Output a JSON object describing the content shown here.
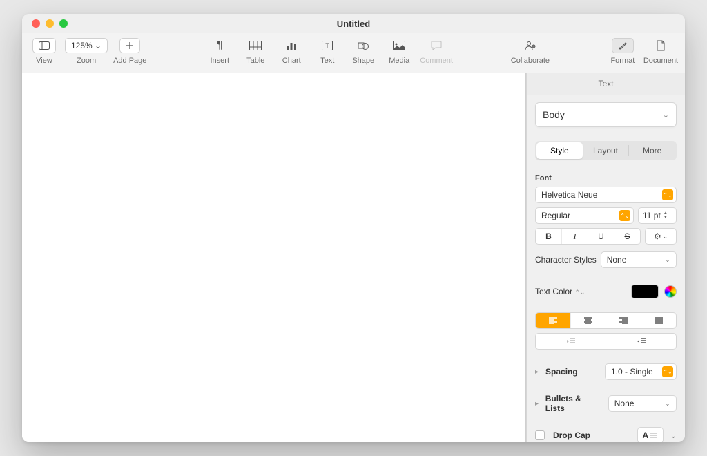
{
  "window": {
    "title": "Untitled"
  },
  "toolbar": {
    "view": "View",
    "zoom": "Zoom",
    "zoom_value": "125% ⌄",
    "add_page": "Add Page",
    "insert": "Insert",
    "table": "Table",
    "chart": "Chart",
    "text": "Text",
    "shape": "Shape",
    "media": "Media",
    "comment": "Comment",
    "collaborate": "Collaborate",
    "format": "Format",
    "document": "Document"
  },
  "inspector": {
    "tab": "Text",
    "paragraph_style": "Body",
    "segments": {
      "style": "Style",
      "layout": "Layout",
      "more": "More"
    },
    "font_label": "Font",
    "font_family": "Helvetica Neue",
    "font_face": "Regular",
    "font_size": "11 pt",
    "bius": {
      "b": "B",
      "i": "I",
      "u": "U",
      "s": "S"
    },
    "char_styles_label": "Character Styles",
    "char_styles_value": "None",
    "text_color_label": "Text Color",
    "spacing_label": "Spacing",
    "spacing_value": "1.0 - Single",
    "bullets_label": "Bullets & Lists",
    "bullets_value": "None",
    "dropcap_label": "Drop Cap",
    "dropcap_glyph": "A"
  }
}
